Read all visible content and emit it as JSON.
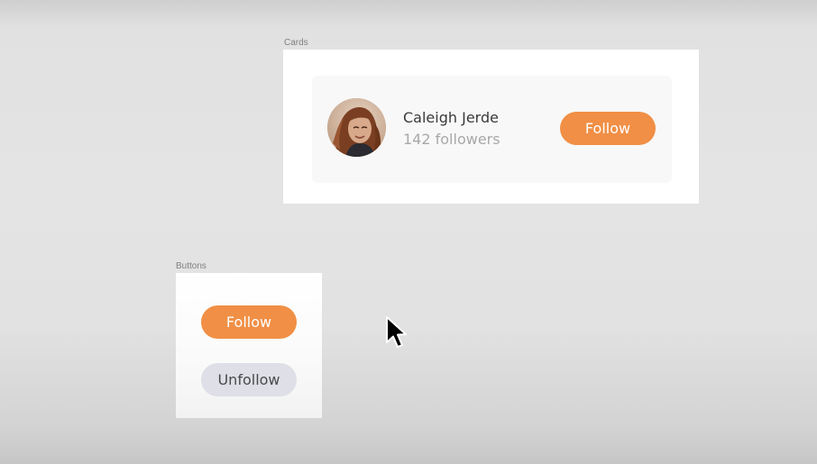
{
  "frames": {
    "cards": {
      "label": "Cards"
    },
    "buttons": {
      "label": "Buttons"
    }
  },
  "card": {
    "name": "Caleigh Jerde",
    "followers": "142 followers",
    "follow_label": "Follow"
  },
  "buttons": {
    "follow_label": "Follow",
    "unfollow_label": "Unfollow"
  },
  "colors": {
    "primary": "#f08f45",
    "secondary": "#dedfe7",
    "canvas": "#e4e4e4"
  },
  "icons": {
    "cursor": "mouse-pointer-icon"
  }
}
